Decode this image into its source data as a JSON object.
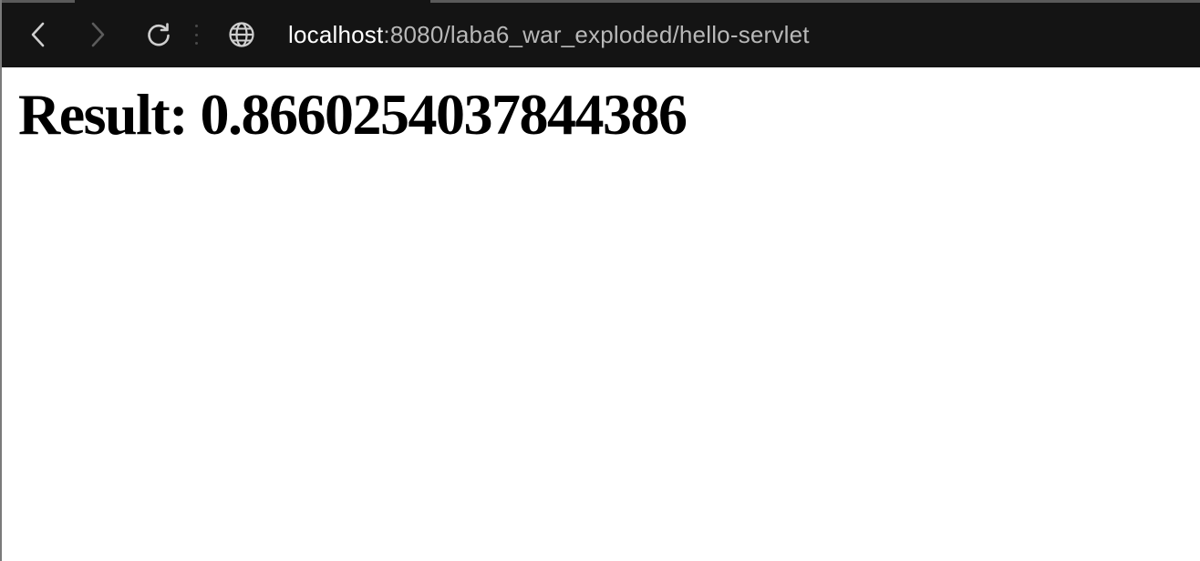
{
  "browser": {
    "url_host": "localhost",
    "url_rest": ":8080/laba6_war_exploded/hello-servlet",
    "icons": {
      "back": "chevron-left-icon",
      "forward": "chevron-right-icon",
      "reload": "reload-icon",
      "site_info": "globe-icon"
    },
    "colors": {
      "toolbar_bg": "#141414",
      "url_host": "#ffffff",
      "url_rest": "#b8b8b8",
      "icon_active": "#cfcfcf",
      "icon_disabled": "#5c5c5c"
    }
  },
  "page": {
    "heading": "Result: 0.8660254037844386"
  }
}
